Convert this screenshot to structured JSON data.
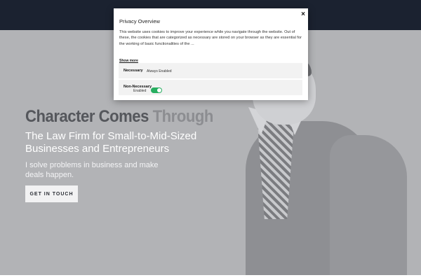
{
  "hero": {
    "headline_main": "Character Comes ",
    "headline_fade": "Through",
    "subhead": "The Law Firm for Small-to-Mid-Sized Businesses and Entrepreneurs",
    "tagline": "I solve problems in business and make deals happen.",
    "cta_label": "GET IN TOUCH"
  },
  "modal": {
    "title": "Privacy Overview",
    "close_label": "×",
    "body": "This website uses cookies to improve your experience while you navigate through the website. Out of these, the cookies that are categorized as necessary are stored on your browser as they are essential for the working of basic functionalities of the ...",
    "show_more": "Show more",
    "categories": [
      {
        "name": "Necessary",
        "status": "Always Enabled"
      },
      {
        "name": "Non-Necessary",
        "status": "Enabled",
        "toggle_on": true
      }
    ]
  },
  "colors": {
    "topbar": "#1b2230",
    "hero_bg": "#b2b3b6",
    "toggle_on": "#27ae60"
  }
}
